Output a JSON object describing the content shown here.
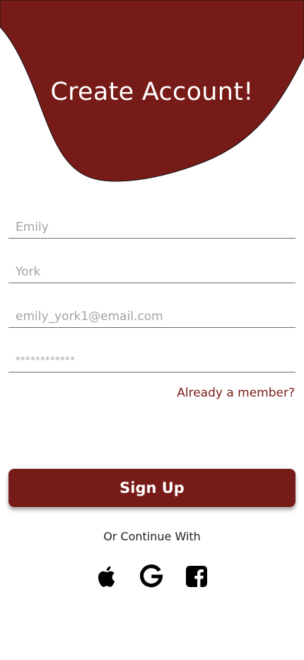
{
  "header": {
    "title": "Create Account!",
    "blob_color": "#771b18"
  },
  "form": {
    "first_name": {
      "placeholder": "Emily"
    },
    "last_name": {
      "placeholder": "York"
    },
    "email": {
      "placeholder": "emily_york1@email.com"
    },
    "password": {
      "placeholder": "************"
    }
  },
  "links": {
    "already_member": "Already a member?"
  },
  "actions": {
    "signup_label": "Sign Up"
  },
  "social": {
    "continue_label": "Or Continue With",
    "icons": [
      "apple-icon",
      "google-icon",
      "facebook-icon"
    ]
  },
  "colors": {
    "accent": "#771b18",
    "text_accent": "#7a1a17",
    "placeholder": "#a3a3a3"
  }
}
